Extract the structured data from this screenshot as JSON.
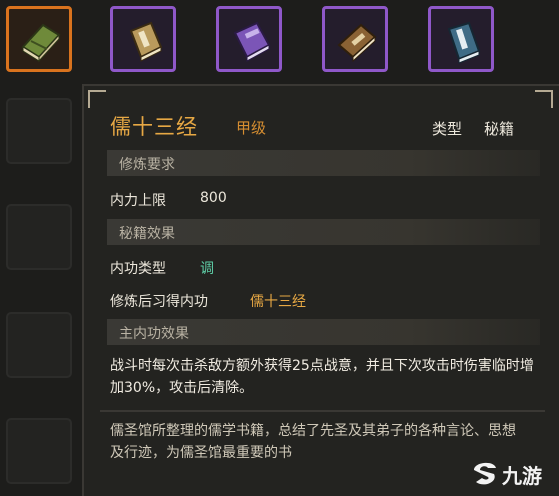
{
  "inventory": {
    "slots": [
      {
        "icon": "green-scroll-book-icon",
        "state": "selected",
        "accent": "#d9731e",
        "cover": "#6f8a3a"
      },
      {
        "icon": "tan-book-icon",
        "state": "rare",
        "accent": "#8f58c9",
        "cover": "#b99a5c"
      },
      {
        "icon": "purple-book-icon",
        "state": "rare",
        "accent": "#8f58c9",
        "cover": "#7b55b7"
      },
      {
        "icon": "brown-book-icon",
        "state": "rare",
        "accent": "#8f58c9",
        "cover": "#8a6234"
      },
      {
        "icon": "blue-book-icon",
        "state": "rare",
        "accent": "#8f58c9",
        "cover": "#3f6c86"
      }
    ]
  },
  "item": {
    "name": "儒十三经",
    "grade": "甲级",
    "type_label": "类型",
    "type_value": "秘籍"
  },
  "sections": {
    "requirements": "修炼要求",
    "effects": "秘籍效果",
    "main_effect": "主内功效果"
  },
  "requirements": {
    "max_inner_label": "内力上限",
    "max_inner_value": "800"
  },
  "effects": {
    "kungfu_type_label": "内功类型",
    "kungfu_type_value": "调",
    "learned_label": "修炼后习得内功",
    "learned_value": "儒十三经"
  },
  "main_effect_text": "战斗时每次击杀敌方额外获得25点战意，并且下次攻击时伤害临时增加30%，攻击后清除。",
  "description": "儒圣馆所整理的儒学书籍，总结了先圣及其弟子的各种言论、思想及行迹，为儒圣馆最重要的书",
  "watermark": "九游",
  "colors": {
    "title": "#e7a844",
    "grade": "#d68e31",
    "type_value_teal": "#5fd0a8",
    "learned_value": "#e7a844"
  }
}
